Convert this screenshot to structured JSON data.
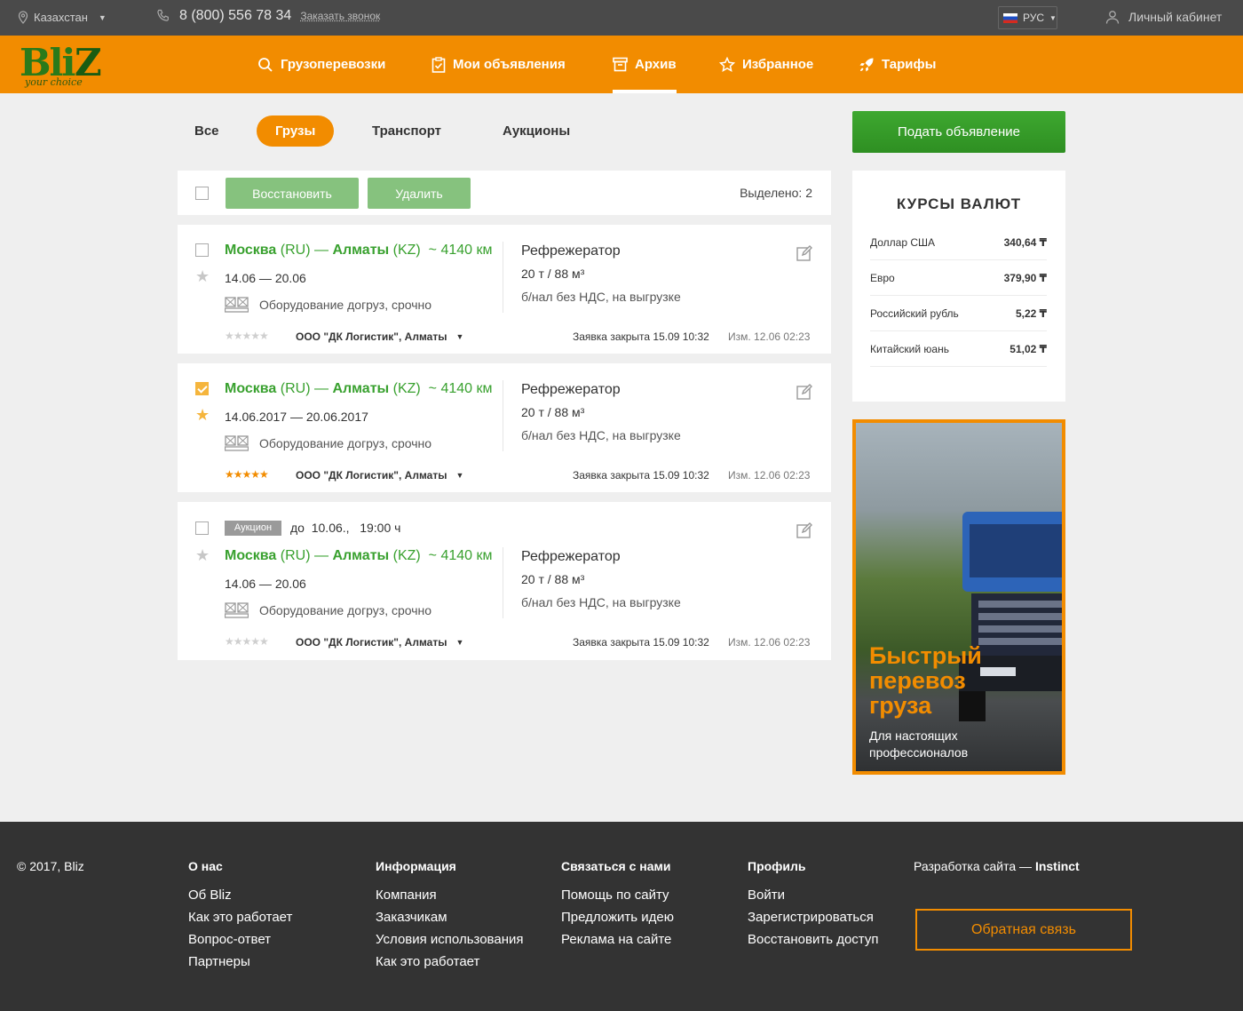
{
  "topbar": {
    "location": "Казахстан",
    "phone": "8 (800) 556 78 34",
    "callback": "Заказать звонок",
    "language": "РУС",
    "cabinet": "Личный кабинет"
  },
  "logo": {
    "text_a": "Bli",
    "text_b": "Z",
    "tagline": "your choice"
  },
  "nav": {
    "items": [
      {
        "label": "Грузоперевозки",
        "icon": "search-icon"
      },
      {
        "label": "Мои объявления",
        "icon": "clipboard-icon"
      },
      {
        "label": "Архив",
        "icon": "archive-icon",
        "active": true
      },
      {
        "label": "Избранное",
        "icon": "star-outline-icon"
      },
      {
        "label": "Тарифы",
        "icon": "rocket-icon"
      }
    ]
  },
  "filters": {
    "all": "Все",
    "cargo": "Грузы",
    "transport": "Транспорт",
    "auctions": "Аукционы",
    "active": "cargo"
  },
  "toolbar": {
    "restore": "Восстановить",
    "delete": "Удалить",
    "selected": "Выделено: 2"
  },
  "listings": [
    {
      "checked": false,
      "starred": false,
      "from": "Москва",
      "from_code": "(RU)",
      "dash": "—",
      "to": "Алматы",
      "to_code": "(KZ)",
      "distance": "~ 4140 км",
      "dates": "14.06 — 20.06",
      "cargo": "Оборудование догруз, срочно",
      "rating": 0,
      "stars": "★★★★★",
      "company": "ООО \"ДК Логистик\", Алматы",
      "transport": "Рефрежератор",
      "load": "20 т / 88 м³",
      "payment": "б/нал без НДС, на выгрузке",
      "closed": "Заявка закрыта 15.09 10:32",
      "modified": "Изм. 12.06  02:23"
    },
    {
      "checked": true,
      "starred": true,
      "from": "Москва",
      "from_code": "(RU)",
      "dash": "—",
      "to": "Алматы",
      "to_code": "(KZ)",
      "distance": "~ 4140 км",
      "dates": "14.06.2017 — 20.06.2017",
      "cargo": "Оборудование догруз, срочно",
      "rating": 5,
      "stars": "★★★★★",
      "company": "ООО \"ДК Логистик\", Алматы",
      "transport": "Рефрежератор",
      "load": "20 т / 88 м³",
      "payment": "б/нал без НДС, на выгрузке",
      "closed": "Заявка закрыта 15.09 10:32",
      "modified": "Изм. 12.06  02:23"
    },
    {
      "checked": false,
      "starred": false,
      "auction_label": "Аукцион",
      "auction_deadline": "до  10.06.,   19:00 ч",
      "from": "Москва",
      "from_code": "(RU)",
      "dash": "—",
      "to": "Алматы",
      "to_code": "(KZ)",
      "distance": "~ 4140 км",
      "dates": "14.06 — 20.06",
      "cargo": "Оборудование догруз, срочно",
      "rating": 0,
      "stars": "★★★★★",
      "company": "ООО \"ДК Логистик\", Алматы",
      "transport": "Рефрежератор",
      "load": "20 т / 88 м³",
      "payment": "б/нал без НДС, на выгрузке",
      "closed": "Заявка закрыта 15.09 10:32",
      "modified": "Изм. 12.06  02:23"
    }
  ],
  "sidebar": {
    "submit": "Подать объявление",
    "rates_title": "КУРСЫ ВАЛЮТ",
    "rates": [
      {
        "name": "Доллар США",
        "value": "340,64 ₸"
      },
      {
        "name": "Евро",
        "value": "379,90 ₸"
      },
      {
        "name": "Российский рубль",
        "value": "5,22 ₸"
      },
      {
        "name": "Китайский юань",
        "value": "51,02 ₸"
      }
    ],
    "ad": {
      "line1": "Быстрый",
      "line2": "перевоз",
      "line3": "груза",
      "sub1": "Для настоящих",
      "sub2": "профессионалов"
    }
  },
  "footer": {
    "copyright": "© 2017, Bliz",
    "columns": [
      {
        "title": "О нас",
        "links": [
          "Об Bliz",
          "Как это работает",
          "Вопрос-ответ",
          "Партнеры"
        ]
      },
      {
        "title": "Информация",
        "links": [
          "Компания",
          "Заказчикам",
          "Условия использования",
          "Как это работает"
        ]
      },
      {
        "title": "Связаться с нами",
        "links": [
          "Помощь по сайту",
          "Предложить идею",
          "Реклама на сайте"
        ]
      },
      {
        "title": "Профиль",
        "links": [
          "Войти",
          "Зарегистрироваться",
          "Восстановить доступ"
        ]
      }
    ],
    "dev_prefix": "Разработка сайта — ",
    "dev_name": "Instinct",
    "feedback": "Обратная связь"
  },
  "colors": {
    "brand_orange": "#f28c00",
    "green": "#39a12f",
    "topbar": "#4a4a4a",
    "footer": "#333333"
  }
}
